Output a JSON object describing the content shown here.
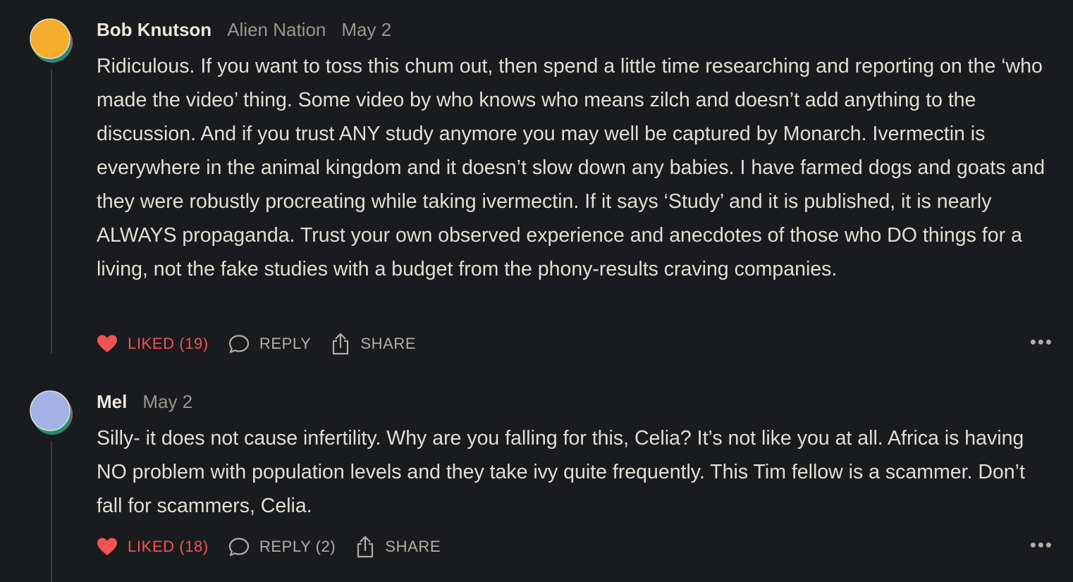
{
  "comments": [
    {
      "author": "Bob Knutson",
      "publication": "Alien Nation",
      "date": "May 2",
      "avatar_colors": {
        "front": "#f5ad2e",
        "back": "#2a8a6f",
        "accent": "#e5533c"
      },
      "text": "Ridiculous. If you want to toss this chum out, then spend a little time researching and reporting on the ‘who made the video’ thing. Some video by who knows who means zilch and doesn’t add anything to the discussion. And if you trust ANY study anymore you may well be captured by Monarch. Ivermectin is everywhere in the animal kingdom and it doesn’t slow down any babies. I have farmed dogs and goats and they were robustly procreating while taking ivermectin. If it says ‘Study’ and it is published, it is nearly ALWAYS propaganda. Trust your own observed experience and anecdotes of those who DO things for a living, not the fake studies with a budget from the phony-results craving companies.",
      "like_label": "LIKED (19)",
      "reply_label": "REPLY",
      "share_label": "SHARE",
      "more_label": "•••"
    },
    {
      "author": "Mel",
      "date": "May 2",
      "avatar_colors": {
        "front": "#a3b2e6",
        "back": "#2a8a6f",
        "accent": "#e5533c"
      },
      "text": "Silly- it does not cause infertility. Why are you falling for this, Celia? It’s not like you at all. Africa is having NO problem with population levels and they take ivy quite frequently. This Tim fellow is a scammer. Don’t fall for scammers, Celia.",
      "like_label": "LIKED (18)",
      "reply_label": "REPLY (2)",
      "share_label": "SHARE",
      "more_label": "•••"
    }
  ],
  "colors": {
    "background": "#1a1b1e",
    "liked": "#f05454",
    "muted": "#9b968e"
  }
}
